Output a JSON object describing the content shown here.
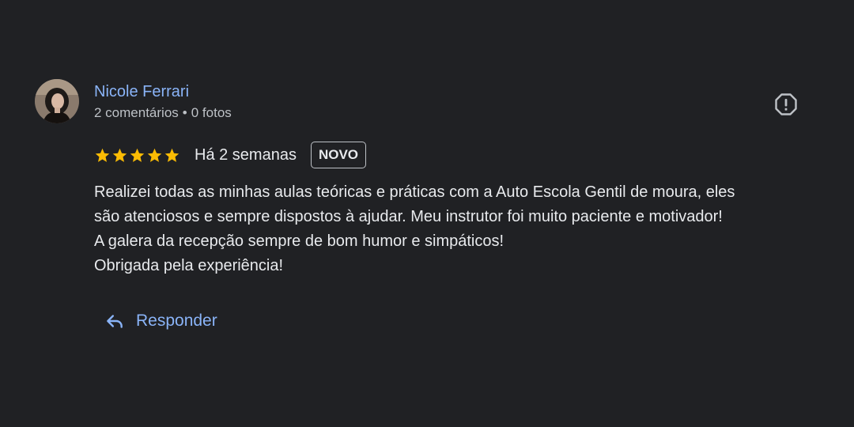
{
  "review": {
    "author": {
      "name": "Nicole Ferrari",
      "reviews_count": "2 comentários",
      "separator": "•",
      "photos_count": "0 fotos"
    },
    "rating": {
      "stars": 5,
      "max": 5,
      "color": "#fbbc04"
    },
    "time": "Há 2 semanas",
    "badge": "NOVO",
    "text_lines": [
      "Realizei todas as minhas aulas teóricas e práticas com a Auto Escola Gentil de moura, eles",
      "são atenciosos e sempre dispostos à ajudar. Meu instrutor foi muito paciente e motivador!",
      "A galera da recepção sempre de bom humor e simpáticos!",
      "Obrigada pela experiência!"
    ],
    "reply_label": "Responder"
  },
  "icons": {
    "report": "report-icon",
    "reply": "reply-arrow-icon",
    "star": "star-icon"
  },
  "colors": {
    "background": "#202124",
    "link": "#8ab4f8",
    "text": "#e8eaed",
    "secondary": "#bdc1c6"
  }
}
